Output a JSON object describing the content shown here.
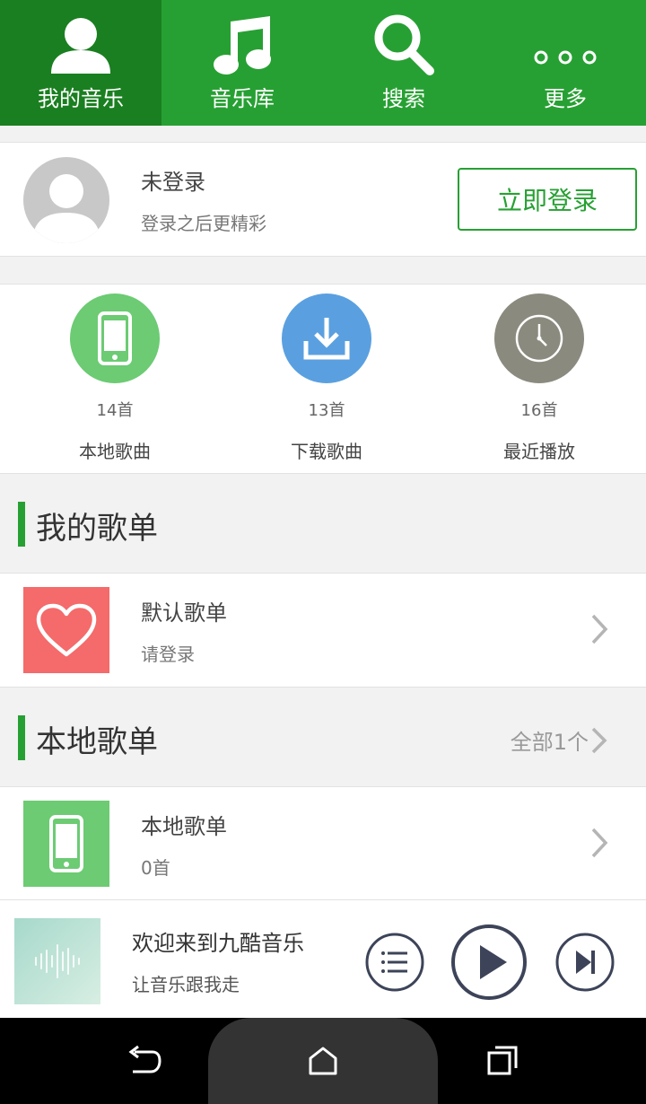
{
  "colors": {
    "brand_green": "#27a033",
    "active_tab": "#1a7f20",
    "local_green": "#6ccb73",
    "download_blue": "#5aa0e0",
    "recent_gray": "#8a8a7e",
    "heart_red": "#f56a6a",
    "player_dark": "#3d4459"
  },
  "tabs": [
    {
      "label": "我的音乐",
      "icon": "user-icon",
      "active": true
    },
    {
      "label": "音乐库",
      "icon": "music-note-icon",
      "active": false
    },
    {
      "label": "搜索",
      "icon": "search-icon",
      "active": false
    },
    {
      "label": "更多",
      "icon": "more-dots-icon",
      "active": false
    }
  ],
  "login": {
    "title": "未登录",
    "subtitle": "登录之后更精彩",
    "button_label": "立即登录"
  },
  "stats": [
    {
      "count": "14首",
      "name": "本地歌曲",
      "icon": "phone-icon"
    },
    {
      "count": "13首",
      "name": "下载歌曲",
      "icon": "download-icon"
    },
    {
      "count": "16首",
      "name": "最近播放",
      "icon": "clock-icon"
    }
  ],
  "my_playlists": {
    "title": "我的歌单",
    "items": [
      {
        "title": "默认歌单",
        "subtitle": "请登录",
        "icon": "heart-icon"
      }
    ]
  },
  "local_playlists": {
    "title": "本地歌单",
    "more_label": "全部1个",
    "items": [
      {
        "title": "本地歌单",
        "subtitle": "0首",
        "icon": "phone-icon"
      }
    ]
  },
  "player": {
    "title": "欢迎来到九酷音乐",
    "subtitle": "让音乐跟我走",
    "controls": [
      "playlist-icon",
      "play-icon",
      "next-icon"
    ]
  },
  "system_nav": [
    "back-icon",
    "home-icon",
    "recents-icon"
  ]
}
